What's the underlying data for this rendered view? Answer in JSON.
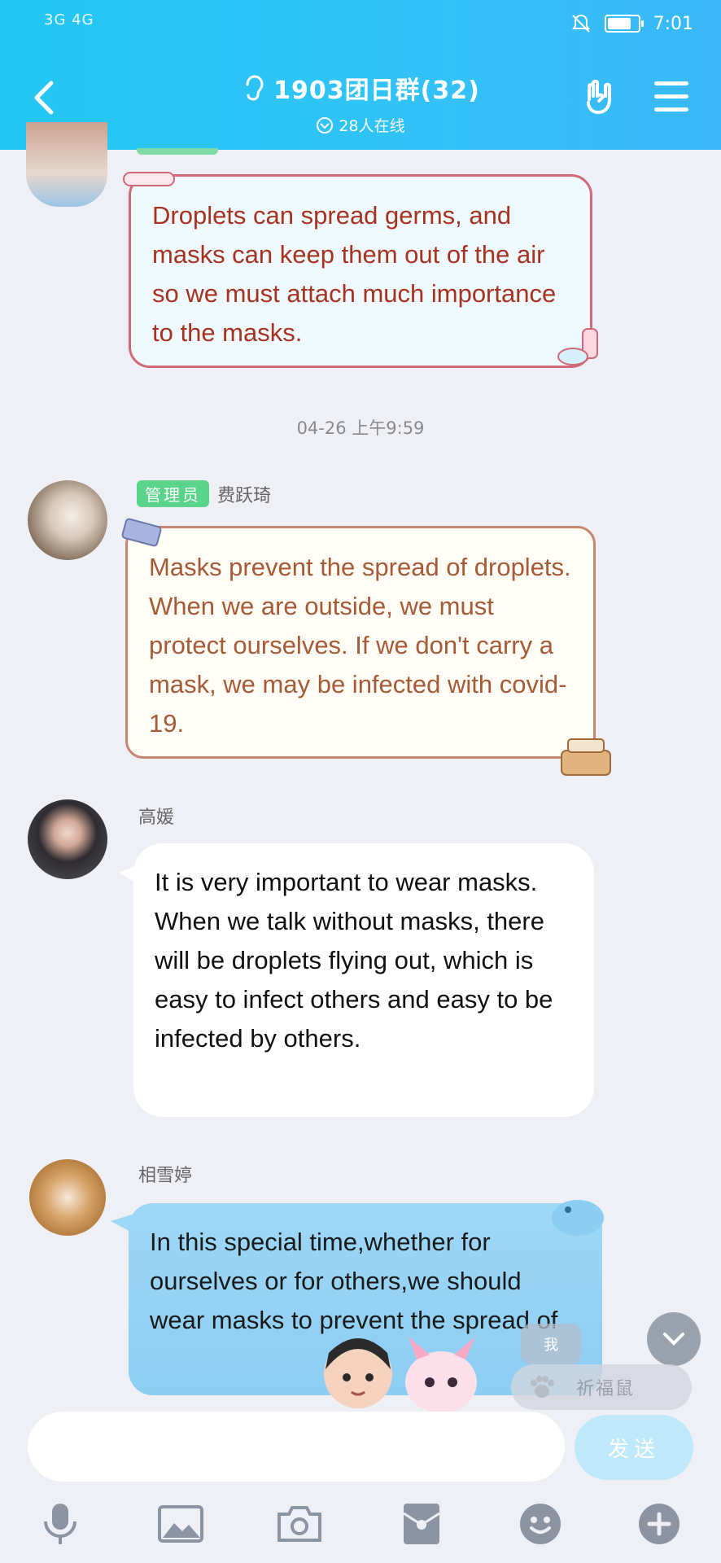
{
  "status": {
    "signal_left": "3G 4G",
    "time": "7:01"
  },
  "header": {
    "title": "1903团日群(32)",
    "online": "28人在线"
  },
  "messages": [
    {
      "text": "Droplets can spread germs, and masks can keep them out of the air so we must attach much importance to the masks."
    },
    {
      "badge": "管理员",
      "sender": "费跃琦",
      "text": "Masks prevent the spread of droplets. When we are outside, we must protect ourselves. If we don't carry a mask, we may be infected with covid-19."
    },
    {
      "sender": "高媛",
      "text": "It is very important to wear masks. When we talk without masks, there will be droplets flying out, which is easy to infect others and easy to be infected by others."
    },
    {
      "sender": "相雪婷",
      "text": "In this special time,whether for ourselves or for others,we should wear masks to prevent the spread of"
    }
  ],
  "timestamp": "04-26 上午9:59",
  "floating": {
    "me_label": "我",
    "pet_name": "祈福鼠"
  },
  "input": {
    "placeholder": "",
    "send_label": "发送"
  },
  "colors": {
    "header": "#2ec4f5",
    "badge": "#5ad38b"
  }
}
